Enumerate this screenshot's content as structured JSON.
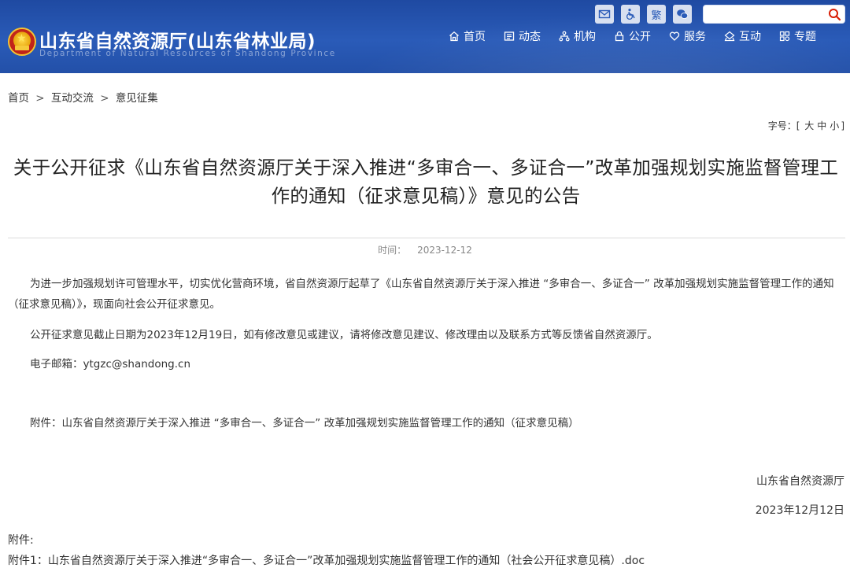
{
  "header": {
    "site_title": "山东省自然资源厅(山东省林业局)",
    "site_subtitle": "Department of Natural Resources of Shandong Province",
    "emblem_icon": "national-emblem-icon",
    "tools": [
      {
        "name": "mail-icon",
        "label": "✉"
      },
      {
        "name": "accessibility-icon",
        "label": "♿"
      },
      {
        "name": "traditional-chinese-icon",
        "label": "繁"
      },
      {
        "name": "wechat-icon",
        "label": "💬"
      }
    ],
    "search": {
      "placeholder": "",
      "value": "",
      "icon": "search-icon"
    },
    "nav": [
      {
        "label": "首页",
        "icon": "home-icon"
      },
      {
        "label": "动态",
        "icon": "news-icon"
      },
      {
        "label": "机构",
        "icon": "org-icon"
      },
      {
        "label": "公开",
        "icon": "lock-icon"
      },
      {
        "label": "服务",
        "icon": "heart-icon"
      },
      {
        "label": "互动",
        "icon": "interact-icon"
      },
      {
        "label": "专题",
        "icon": "topic-icon"
      }
    ],
    "colors": {
      "primary": "#2a5bb8",
      "accent_red": "#d81e06"
    }
  },
  "breadcrumb": {
    "items": [
      "首页",
      "互动交流",
      "意见征集"
    ],
    "separator": ">"
  },
  "font_size": {
    "label": "字号：",
    "open": "[",
    "options": [
      "大",
      "中",
      "小"
    ],
    "close": "]"
  },
  "article": {
    "title": "关于公开征求《山东省自然资源厅关于深入推进“多审合一、多证合一”改革加强规划实施监督管理工作的通知（征求意见稿）》意见的公告",
    "time_label": "时间：",
    "time_value": "2023-12-12",
    "paragraphs": [
      "为进一步加强规划许可管理水平，切实优化营商环境，省自然资源厅起草了《山东省自然资源厅关于深入推进 “多审合一、多证合一” 改革加强规划实施监督管理工作的通知（征求意见稿）》，现面向社会公开征求意见。",
      "公开征求意见截止日期为2023年12月19日，如有修改意见或建议，请将修改意见建议、修改理由以及联系方式等反馈省自然资源厅。",
      "电子邮箱：ytgzc@shandong.cn",
      "附件：山东省自然资源厅关于深入推进 “多审合一、多证合一” 改革加强规划实施监督管理工作的通知（征求意见稿）"
    ],
    "signature_org": "山东省自然资源厅",
    "signature_date": "2023年12月12日",
    "attachments_heading": "附件:",
    "attachments": [
      {
        "label": "附件1：",
        "name": "山东省自然资源厅关于深入推进“多审合一、多证合一”改革加强规划实施监督管理工作的通知（社会公开征求意见稿）.doc"
      }
    ]
  }
}
